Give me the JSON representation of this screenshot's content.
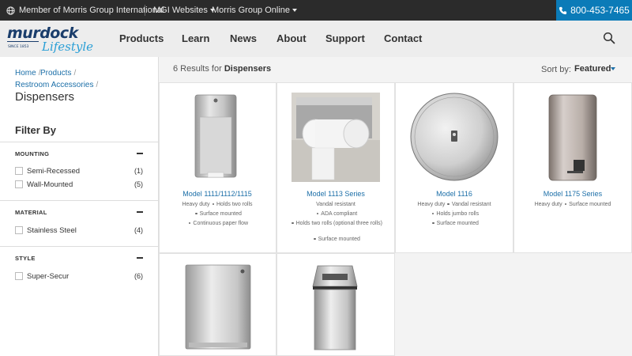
{
  "topbar": {
    "member_text": "Member of Morris Group International",
    "mgi_websites": "MGI Websites",
    "morris_online": "Morris Group Online",
    "phone": "800-453-7465"
  },
  "logo": {
    "brand": "murdock",
    "script": "Lifestyle",
    "since": "SINCE 1853"
  },
  "nav": {
    "products": "Products",
    "learn": "Learn",
    "news": "News",
    "about": "About",
    "support": "Support",
    "contact": "Contact"
  },
  "breadcrumb": {
    "home": "Home",
    "products": "Products",
    "restroom": "Restroom Accessories",
    "current": "Dispensers"
  },
  "filter": {
    "title": "Filter By",
    "mounting": {
      "label": "MOUNTING",
      "options": [
        {
          "label": "Semi-Recessed",
          "count": "(1)"
        },
        {
          "label": "Wall-Mounted",
          "count": "(5)"
        }
      ]
    },
    "material": {
      "label": "MATERIAL",
      "options": [
        {
          "label": "Stainless Steel",
          "count": "(4)"
        }
      ]
    },
    "style": {
      "label": "STYLE",
      "options": [
        {
          "label": "Super-Secur",
          "count": "(6)"
        }
      ]
    }
  },
  "results": {
    "count": "6 Results for",
    "term": "Dispensers"
  },
  "sort": {
    "label": "Sort by:",
    "value": "Featured"
  },
  "products": [
    {
      "model_prefix": "Model ",
      "model_num": "1111/1112/1115",
      "f1": "Heavy duty",
      "f2": "Holds two rolls",
      "f3": "Surface mounted",
      "f4": "Continuous paper flow"
    },
    {
      "model_prefix": "Model ",
      "model_num": "1113 Series",
      "f1": "Vandal resistant",
      "f2": "ADA compliant",
      "f3": "Holds two rolls (optional three rolls)",
      "f4": "Surface mounted"
    },
    {
      "model_prefix": "Model ",
      "model_num": "1116",
      "f1": "Heavy duty",
      "f2": "Vandal resistant",
      "f3": "Holds jumbo rolls",
      "f4": "Surface mounted"
    },
    {
      "model_prefix": "Model ",
      "model_num": "1175 Series",
      "f1": "Heavy duty",
      "f2": "Surface mounted"
    }
  ],
  "colors": {
    "accent": "#1c6fa8",
    "phone_bg": "#0b7bb8",
    "topbar_bg": "#2b2b2b",
    "nav_bg": "#ededed"
  }
}
